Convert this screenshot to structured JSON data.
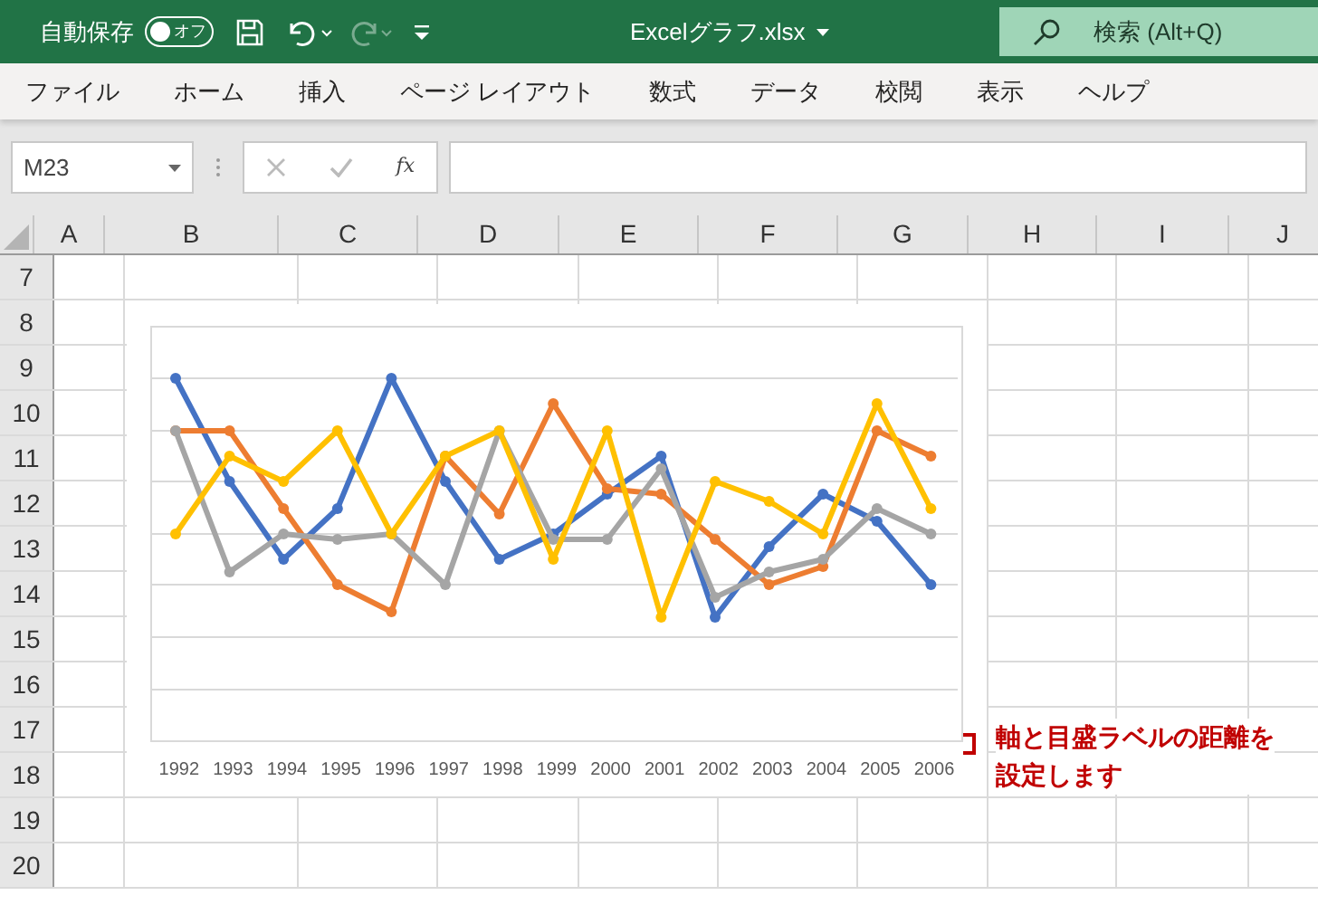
{
  "title_bar": {
    "autosave_label": "自動保存",
    "autosave": {
      "on": false,
      "label": "オフ"
    },
    "filename": "Excelグラフ.xlsx",
    "search_placeholder": "検索 (Alt+Q)"
  },
  "menu": [
    "ファイル",
    "ホーム",
    "挿入",
    "ページ レイアウト",
    "数式",
    "データ",
    "校閲",
    "表示",
    "ヘルプ"
  ],
  "formula_bar": {
    "name_box": "M23",
    "fx": "fx"
  },
  "columns": [
    "A",
    "B",
    "C",
    "D",
    "E",
    "F",
    "G",
    "H",
    "I",
    "J"
  ],
  "rows": [
    "7",
    "8",
    "9",
    "10",
    "11",
    "12",
    "13",
    "14",
    "15",
    "16",
    "17",
    "18",
    "19",
    "20"
  ],
  "chart": {
    "x_labels": [
      "1992",
      "1993",
      "1994",
      "1995",
      "1996",
      "1997",
      "1998",
      "1999",
      "2000",
      "2001",
      "2002",
      "2003",
      "2004",
      "2005",
      "2006"
    ]
  },
  "annotation": {
    "lines": [
      "軸と目盛ラベルの距離を",
      "設定します"
    ]
  }
}
